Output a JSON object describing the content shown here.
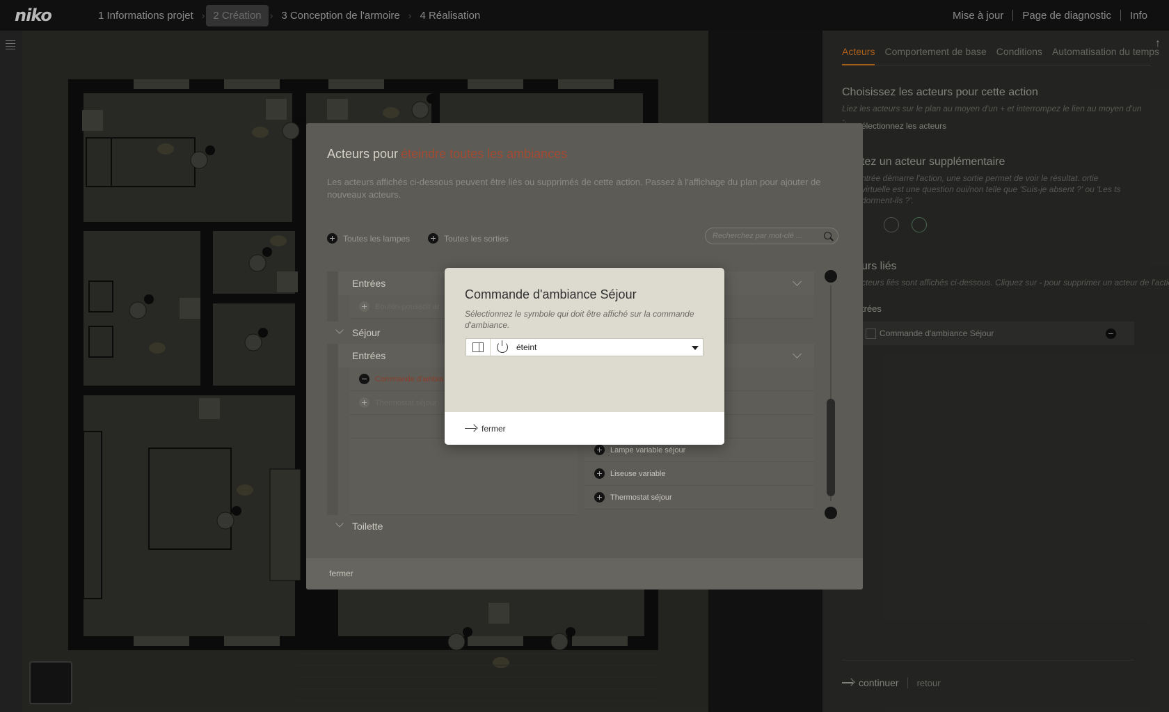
{
  "app": {
    "logo": "niko"
  },
  "steps": [
    {
      "label": "1 Informations projet",
      "active": false
    },
    {
      "label": "2 Création",
      "active": true
    },
    {
      "label": "3 Conception de l'armoire",
      "active": false
    },
    {
      "label": "4 Réalisation",
      "active": false
    }
  ],
  "toplinks": [
    "Mise à jour",
    "Page de diagnostic",
    "Info"
  ],
  "right_panel": {
    "tabs": [
      "Acteurs",
      "Comportement de base",
      "Conditions",
      "Automatisation du temps"
    ],
    "choose_title": "Choisissez les acteurs pour cette action",
    "choose_desc": "Liez les acteurs sur le plan au moyen d'un + et interrompez le lien au moyen d'un -.",
    "select_link": "électionnez les acteurs",
    "extra_title": "tez un acteur supplémentaire",
    "extra_desc": "ntrée démarre l'action, une sortie permet de voir le résultat. ortie virtuelle est une question oui/non telle que 'Suis-je absent ?' ou 'Les ts dorment-ils ?'.",
    "linked_title": "urs liés",
    "linked_desc": "cteurs liés sont affichés ci-dessous. Cliquez sur - pour supprimer un acteur de l'action",
    "linked_group": "trées",
    "linked_item": "Commande d'ambiance Séjour",
    "continue": "continuer",
    "back": "retour"
  },
  "actors_dialog": {
    "title_prefix": "Acteurs pour",
    "title_highlight": "éteindre toutes les ambiances",
    "description": "Les acteurs affichés ci-dessous peuvent être liés ou supprimés de cette action. Passez à l'affichage du plan pour ajouter de nouveaux acteurs.",
    "add_all_lamps": "Toutes les lampes",
    "add_all_outputs": "Toutes les sorties",
    "search_placeholder": "Recherchez par mot-clé ...",
    "section_inputs_1": "Entrées",
    "dimmed_item_1": "Bouton-poussoir ar",
    "room_1": "Séjour",
    "section_inputs_2": "Entrées",
    "linked_item": "Commande d'ambia",
    "dimmed_item_2": "Thermostat séjour",
    "outputs": [
      "Lampe variable séjour",
      "Liseuse variable",
      "Thermostat séjour"
    ],
    "room_2": "Toilette",
    "close": "fermer"
  },
  "modal": {
    "title": "Commande d'ambiance Séjour",
    "description": "Sélectionnez le symbole qui doit être affiché sur la commande d'ambiance.",
    "selected_value": "éteint",
    "symbol_icon": "scene-control-icon",
    "value_icon": "power-icon",
    "close": "fermer"
  }
}
